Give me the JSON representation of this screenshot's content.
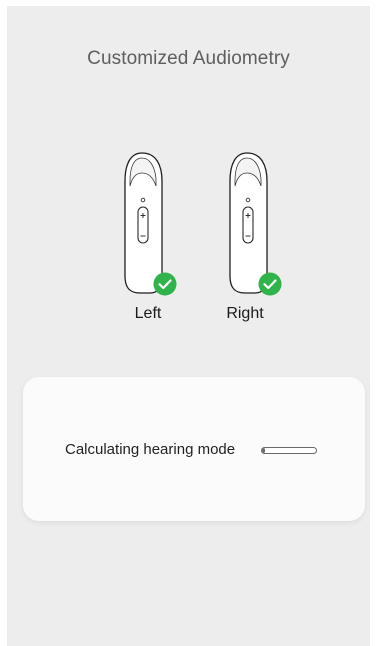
{
  "header": {
    "title": "Customized Audiometry"
  },
  "devices": [
    {
      "label": "Left",
      "status": "check-complete-icon",
      "status_color": "#2fb34a"
    },
    {
      "label": "Right",
      "status": "check-complete-icon",
      "status_color": "#2fb34a"
    }
  ],
  "status_card": {
    "text": "Calculating hearing mode",
    "progress": 0.05
  },
  "colors": {
    "background": "#eeeded",
    "card": "#fbfbfb",
    "success": "#2fb34a"
  }
}
